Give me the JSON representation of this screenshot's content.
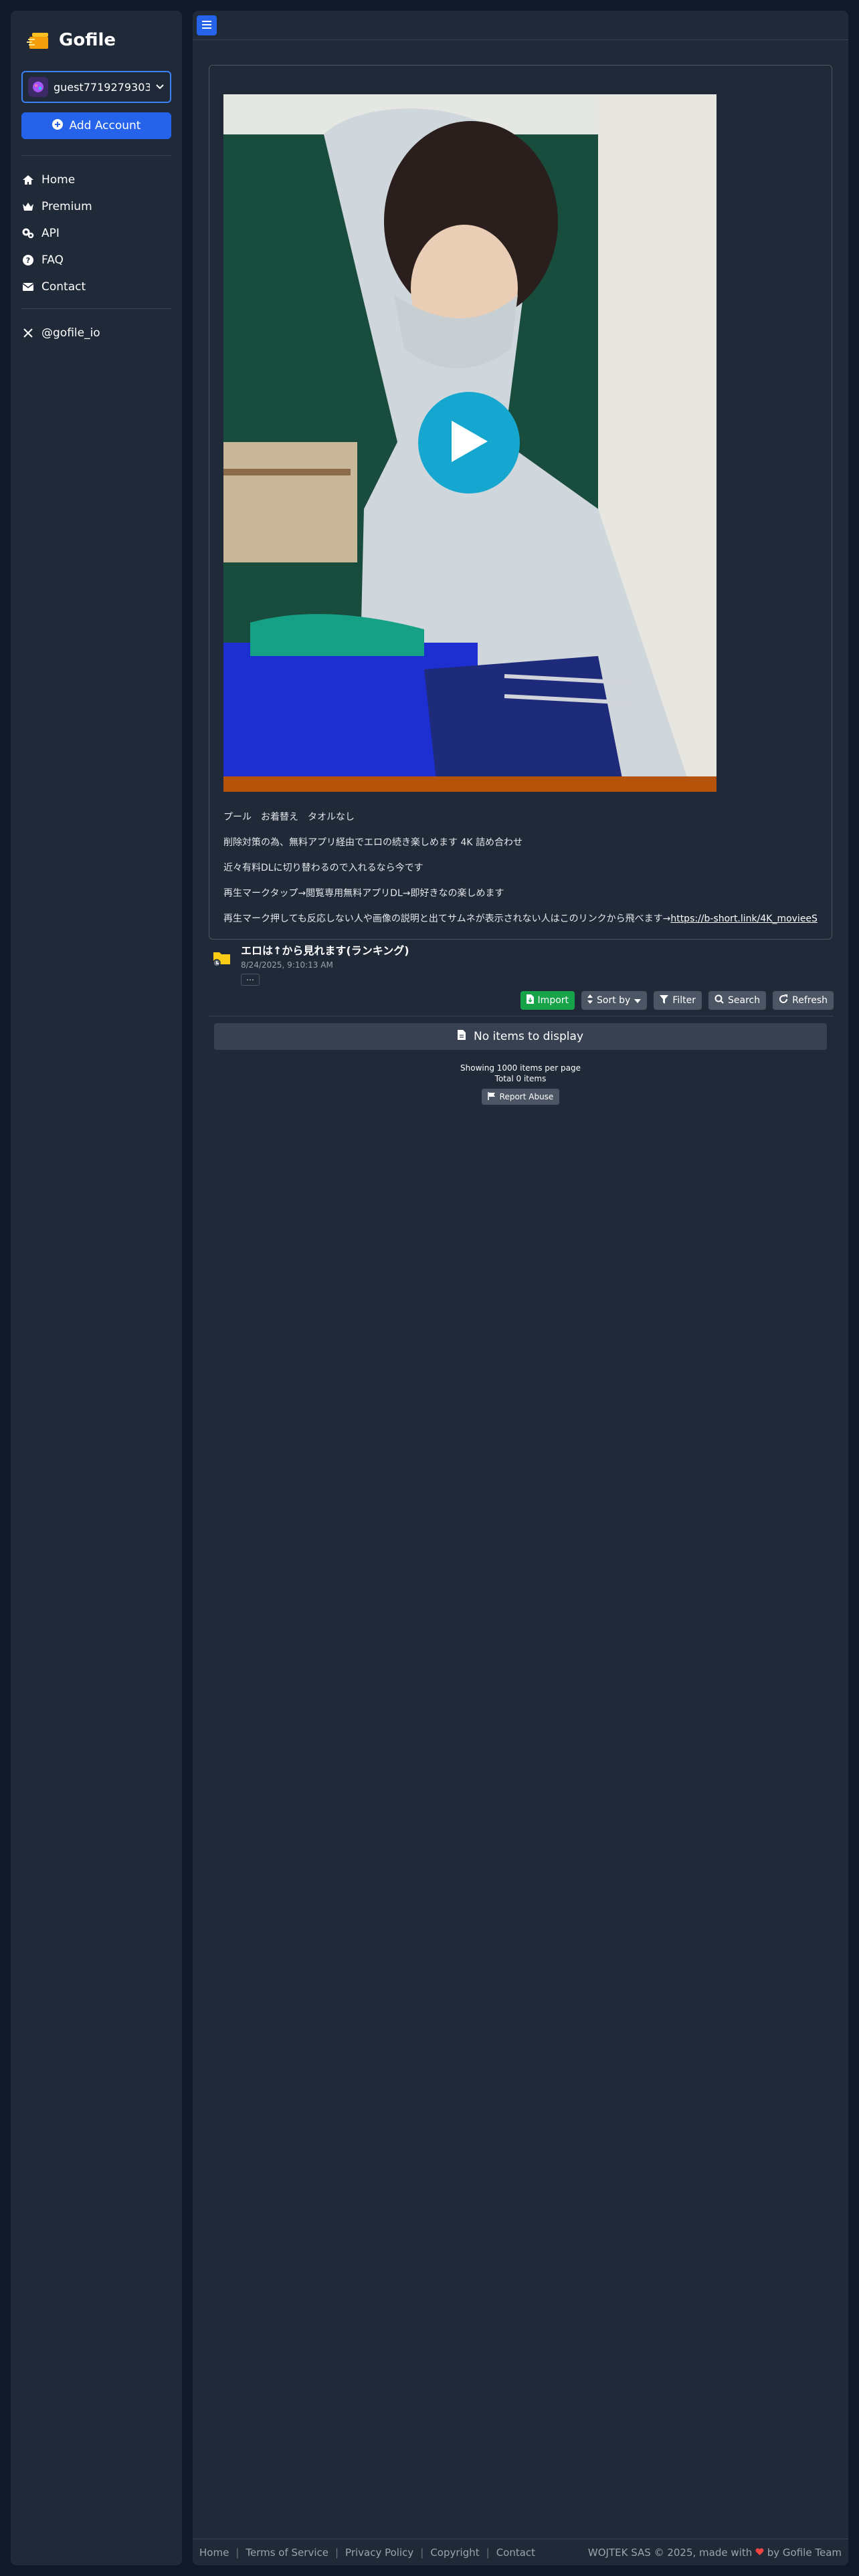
{
  "brand": {
    "name": "Gofile"
  },
  "account": {
    "username": "guest7719279303",
    "add_label": "Add Account"
  },
  "nav": {
    "items": [
      {
        "label": "Home",
        "icon": "home-icon"
      },
      {
        "label": "Premium",
        "icon": "crown-icon"
      },
      {
        "label": "API",
        "icon": "gears-icon"
      },
      {
        "label": "FAQ",
        "icon": "question-icon"
      },
      {
        "label": "Contact",
        "icon": "envelope-icon"
      }
    ],
    "social": {
      "label": "@gofile_io",
      "icon": "x-logo-icon"
    }
  },
  "description": {
    "lines": [
      "プール　お着替え　タオルなし",
      "削除対策の為、無料アプリ経由でエロの続き楽しめます 4K 詰め合わせ",
      "近々有料DLに切り替わるので入れるなら今です",
      "再生マークタップ→閲覧専用無料アプリDL→即好きなの楽しめます"
    ],
    "last_line_prefix": "再生マーク押しても反応しない人や画像の説明と出てサムネが表示されない人はこのリンクから飛べます→",
    "link_text": "https://b-short.link/4K_movieeS"
  },
  "folder": {
    "title": "エロは↑から見れます(ランキング)",
    "date": "8/24/2025, 9:10:13 AM",
    "more_label": "⋯"
  },
  "toolbar": {
    "import": "Import",
    "sort": "Sort by",
    "filter": "Filter",
    "search": "Search",
    "refresh": "Refresh"
  },
  "content": {
    "empty": "No items to display",
    "per_page": "Showing 1000 items per page",
    "total": "Total 0 items",
    "report": "Report Abuse"
  },
  "footer": {
    "links": [
      "Home",
      "Terms of Service",
      "Privacy Policy",
      "Copyright",
      "Contact"
    ],
    "copyright_prefix": "WOJTEK SAS © 2025, made with",
    "copyright_suffix": "by Gofile Team",
    "heart_color": "#ef4444"
  },
  "colors": {
    "accent": "#2563eb",
    "success": "#16a34a",
    "panel": "#1f2937",
    "background": "#111827"
  }
}
